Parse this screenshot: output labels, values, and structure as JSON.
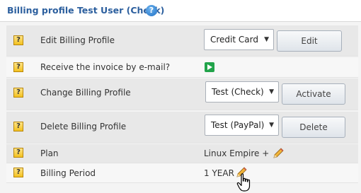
{
  "header": {
    "title": "Billing profile Test User (Check)",
    "help_glyph": "?"
  },
  "rows": {
    "edit": {
      "label": "Edit Billing Profile",
      "select_value": "Credit Card",
      "button": "Edit"
    },
    "email": {
      "label": "Receive the invoice by e-mail?"
    },
    "change": {
      "label": "Change Billing Profile",
      "select_value": "Test (Check)",
      "button": "Activate"
    },
    "delete": {
      "label": "Delete Billing Profile",
      "select_value": "Test (PayPal)",
      "button": "Delete"
    },
    "plan": {
      "label": "Plan",
      "value": "Linux Empire +"
    },
    "period": {
      "label": "Billing Period",
      "value": "1 YEAR"
    }
  },
  "icons": {
    "help": "question-mark-icon",
    "toggle": "play-icon",
    "edit": "pencil-icon",
    "cursor": "hand-pointer-icon"
  },
  "colors": {
    "title": "#2c5f9e",
    "help_bg": "#1e6fc4",
    "toggle_green": "#21a34a",
    "q_icon_yellow": "#f3c11f"
  }
}
